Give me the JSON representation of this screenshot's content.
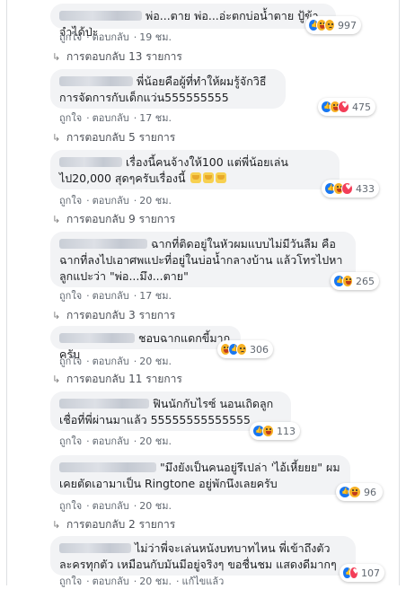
{
  "comments": [
    {
      "name": "",
      "text": "พ่อ...ตาย พ่อ...อ่ะตกบ่อน้ำตาย ปู้ข้าจำได้ป่ะ",
      "like": "ถูกใจ",
      "reply": "ตอบกลับ",
      "time": "19 ชม.",
      "reaction_count": "997",
      "reactions": [
        "like",
        "haha",
        "sad"
      ],
      "replies_label": "การตอบกลับ 13 รายการ"
    },
    {
      "name": "",
      "text": "พี่น้อยคือผู้ที่ทำให้ผมรู้จักวิธีการจัดการกับเด็กแว่น555555555",
      "like": "ถูกใจ",
      "reply": "ตอบกลับ",
      "time": "17 ชม.",
      "reaction_count": "475",
      "reactions": [
        "like",
        "haha",
        "love"
      ],
      "replies_label": "การตอบกลับ 5 รายการ"
    },
    {
      "name": "",
      "text": "เรื่องนี้คนจ้างให้100 แต่พี่น้อยเล่นไป20,000 สุดๆครับเรื่องนี้",
      "like": "ถูกใจ",
      "reply": "ตอบกลับ",
      "time": "20 ชม.",
      "reaction_count": "433",
      "reactions": [
        "like",
        "haha",
        "love"
      ],
      "replies_label": "การตอบกลับ 9 รายการ"
    },
    {
      "name": "",
      "text": "ฉากที่ติดอยู่ในหัวผมแบบไม่มีวันลืม คือฉากที่ลงไปเอาศพแปะที่อยู่ในบ่อน้ำกลางบ้าน แล้วโทรไปหาลูกแปะว่า \"พ่อ...มึง...ตาย\"",
      "like": "ถูกใจ",
      "reply": "ตอบกลับ",
      "time": "17 ชม.",
      "reaction_count": "265",
      "reactions": [
        "like",
        "haha"
      ],
      "replies_label": "การตอบกลับ 3 รายการ"
    },
    {
      "name": "",
      "text": "ชอบฉากแดกขี้มากครับ",
      "like": "ถูกใจ",
      "reply": "ตอบกลับ",
      "time": "20 ชม.",
      "reaction_count": "306",
      "reactions": [
        "haha",
        "like",
        "sad"
      ],
      "replies_label": "การตอบกลับ 11 รายการ"
    },
    {
      "name": "",
      "text": "ฟินนักกับไรซ์ นอนเถิดลูก เชื่อที่พี่ผ่านมาแล้ว 55555555555555",
      "like": "ถูกใจ",
      "reply": "ตอบกลับ",
      "time": "20 ชม.",
      "reaction_count": "113",
      "reactions": [
        "like",
        "haha"
      ],
      "replies_label": ""
    },
    {
      "name": "",
      "text": "\"มึงยังเป็นคนอยู่รึเปล่า 'ไอ้เหี้ยยย\" ผมเคยตัดเอามาเป็น Ringtone อยู่พักนึงเลยครับ",
      "like": "ถูกใจ",
      "reply": "ตอบกลับ",
      "time": "20 ชม.",
      "reaction_count": "96",
      "reactions": [
        "like",
        "haha"
      ],
      "replies_label": "การตอบกลับ 2 รายการ"
    },
    {
      "name": "",
      "text": "ไม่ว่าพี่จะเล่นหนังบทบาทไหน พี่เข้าถึงตัวละครทุกตัว เหมือนกับมันมีอยู่จริงๆ ขอชื่นชม แสดงดีมากๆ",
      "like": "ถูกใจ",
      "reply": "ตอบกลับ",
      "time": "20 ชม.",
      "edited": "แก้ไขแล้ว",
      "reaction_count": "107",
      "reactions": [
        "like",
        "love"
      ],
      "replies_label": ""
    }
  ],
  "colors": {
    "bubble": "#f2f3f5",
    "meta": "#606770",
    "like": "#1877f2",
    "haha": "#f7b125",
    "love": "#f33e58"
  }
}
